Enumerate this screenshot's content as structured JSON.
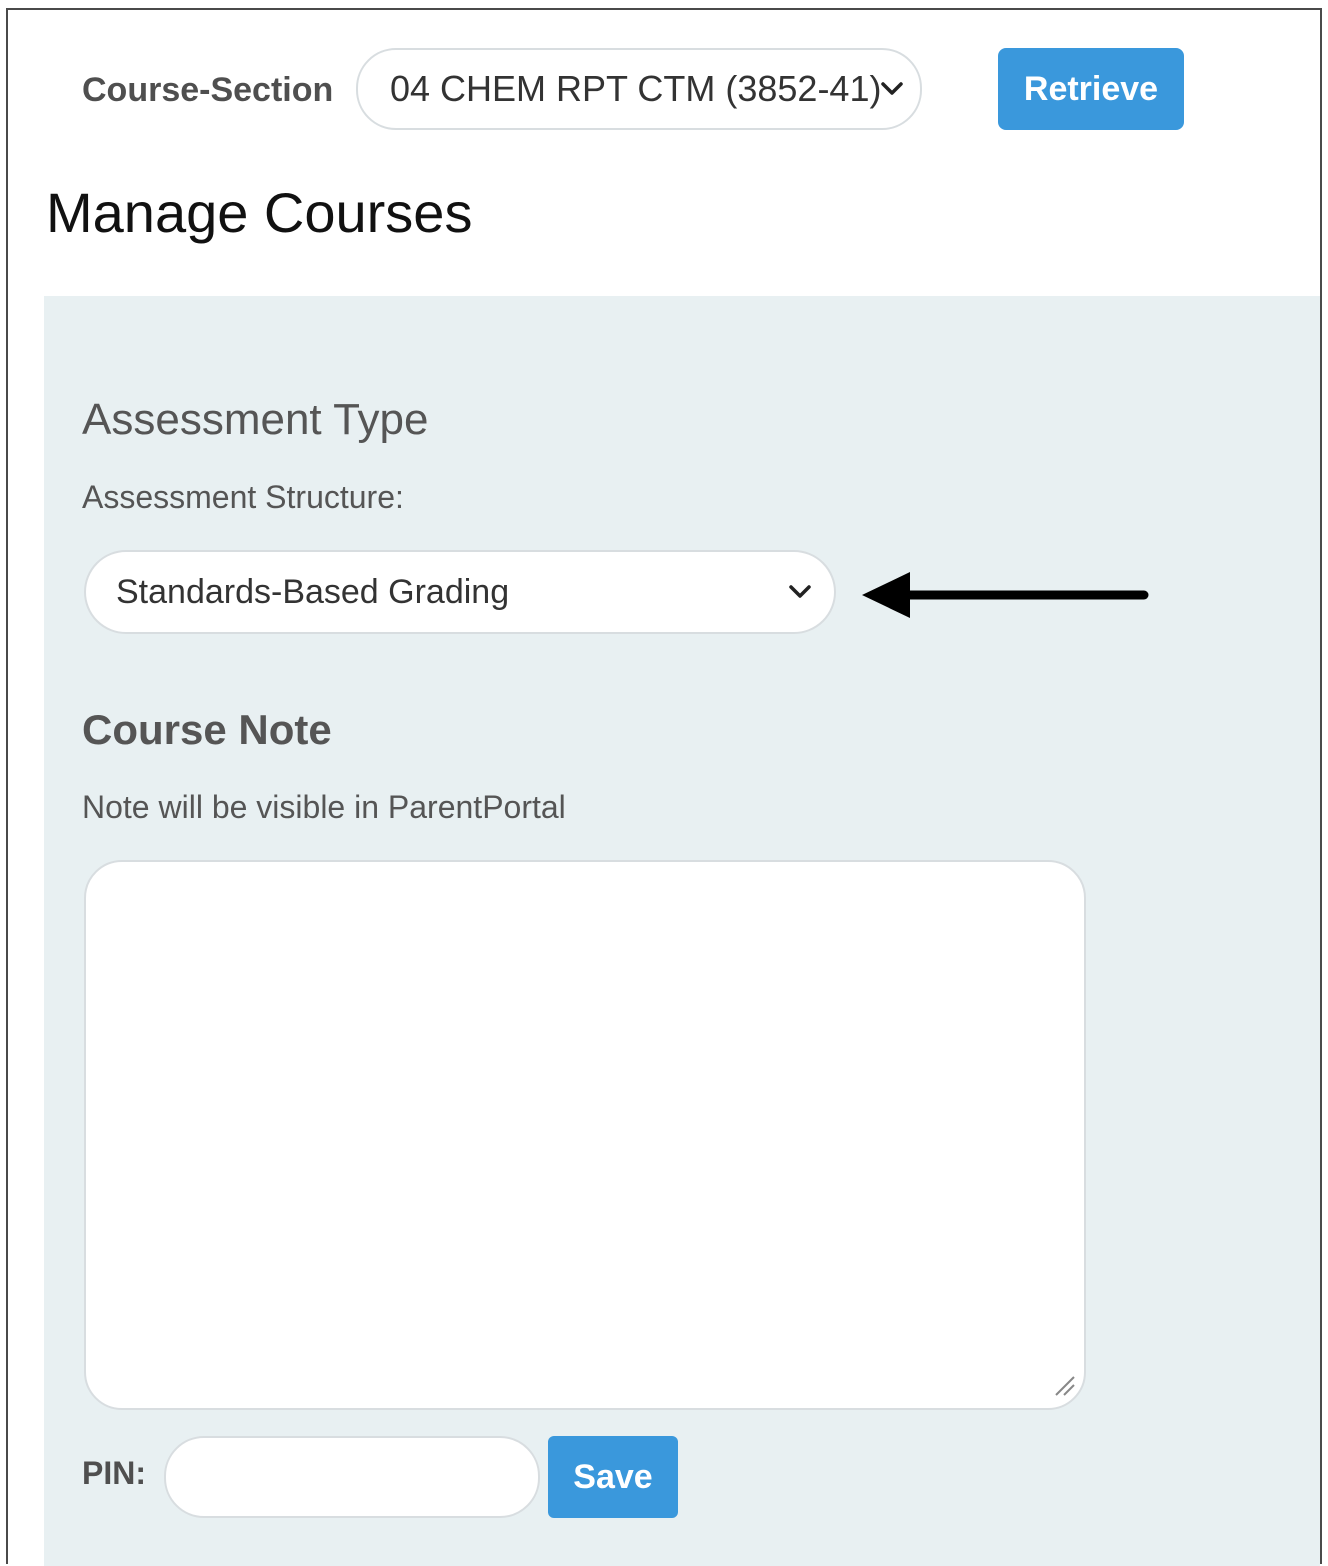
{
  "header": {
    "course_section_label": "Course-Section",
    "course_section_value": "04 CHEM RPT CTM (3852-41)",
    "retrieve_label": "Retrieve",
    "page_title": "Manage Courses"
  },
  "assessment": {
    "section_title": "Assessment Type",
    "structure_label": "Assessment Structure:",
    "structure_value": "Standards-Based Grading"
  },
  "course_note": {
    "title": "Course Note",
    "hint": "Note will be visible in ParentPortal",
    "note_value": ""
  },
  "pin": {
    "label": "PIN:",
    "value": "",
    "save_label": "Save"
  },
  "colors": {
    "accent": "#3a98dc",
    "panel_background": "#e8f0f2"
  },
  "icons": {
    "dropdown": "chevron-down-icon",
    "annotation": "arrow-left-icon",
    "resize": "resize-handle-icon"
  }
}
